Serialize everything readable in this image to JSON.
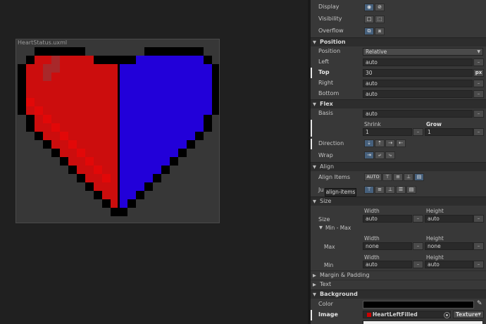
{
  "canvas": {
    "title": "HeartStatus.uxml",
    "colors": {
      "left_fill": "#cc0d0d",
      "left_shade": "#e20808",
      "left_highlight": "#a8282a",
      "right_fill": "#2200d9",
      "outline": "#000000",
      "background": "#373737"
    }
  },
  "display": {
    "display_label": "Display",
    "visibility_label": "Visibility",
    "overflow_label": "Overflow"
  },
  "position": {
    "section": "Position",
    "position_label": "Position",
    "position_value": "Relative",
    "left_label": "Left",
    "left_value": "auto",
    "top_label": "Top",
    "top_value": "30",
    "top_unit": "px",
    "right_label": "Right",
    "right_value": "auto",
    "bottom_label": "Bottom",
    "bottom_value": "auto"
  },
  "flex": {
    "section": "Flex",
    "basis_label": "Basis",
    "basis_value": "auto",
    "shrink_label": "Shrink",
    "shrink_value": "1",
    "grow_label": "Grow",
    "grow_value": "1",
    "direction_label": "Direction",
    "wrap_label": "Wrap"
  },
  "align": {
    "section": "Align",
    "align_items_label": "Align Items",
    "auto_label": "AUTO",
    "justify_label": "Ju",
    "tooltip": "align-items"
  },
  "size": {
    "section": "Size",
    "width_label": "Width",
    "height_label": "Height",
    "size_label": "Size",
    "width_value": "auto",
    "height_value": "auto",
    "min_max_label": "Min - Max",
    "max_label": "Max",
    "max_width_label": "Width",
    "max_height_label": "Height",
    "max_width_value": "none",
    "max_height_value": "none",
    "min_label": "Min",
    "min_width_label": "Width",
    "min_height_label": "Height",
    "min_width_value": "auto",
    "min_height_value": "auto"
  },
  "collapsed": {
    "margin_padding": "Margin & Padding",
    "text": "Text"
  },
  "background": {
    "section": "Background",
    "color_label": "Color",
    "image_label": "Image",
    "image_value": "HeartLeftFilled",
    "image_type": "Texture"
  }
}
